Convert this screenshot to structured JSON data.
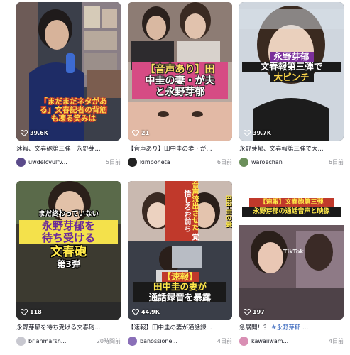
{
  "cards": [
    {
      "likes": "39.6K",
      "overlay": [
        "「まだまだネタがあ",
        "る」文春記者の背筋",
        "も凍る笑みは"
      ],
      "description": "速報、文春砲第三弾　永野芽...",
      "author": "uwdelcvulfv...",
      "date": "5日前",
      "avatar_color": "#5a4a8a"
    },
    {
      "likes": "21",
      "overlay": [
        "【音声あり】田",
        "中圭の妻・が夫",
        "と永野芽郁"
      ],
      "description": "【音声あり】田中圭の妻・が...",
      "author": "kimboheta",
      "date": "6日前",
      "avatar_color": "#222222"
    },
    {
      "likes": "39.7K",
      "overlay": [
        "永野芽郁",
        "文春報第三弾で",
        "大ピンチ"
      ],
      "description": "永野芽郁、文春報第三弾で大...",
      "author": "waroechan",
      "date": "6日前",
      "avatar_color": "#6b8f5a"
    },
    {
      "likes": "118",
      "overlay": [
        "まだ終わっていない",
        "永野芽郁を",
        "待ち受ける",
        "文春砲",
        "第3弾"
      ],
      "description": "永野芽郁を待ち受ける文春砲...",
      "author": "brianmarsh...",
      "date": "20時間前",
      "avatar_color": "#c8c8d0"
    },
    {
      "likes": "44.9K",
      "overlay": [
        "【速報】",
        "田中圭の妻が",
        "通話録音を暴露"
      ],
      "side_text": [
        "音声流出させた",
        "覚悟しろお前ら",
        "田中圭の妻"
      ],
      "description": "【速報】田中圭の妻が通話録...",
      "author": "banossione...",
      "date": "4日前",
      "avatar_color": "#8a6fb8"
    },
    {
      "likes": "197",
      "overlay": [
        "【速報】文春砲第三弾",
        "永野芽郁の通話音声と映像"
      ],
      "watermark": "TikTok",
      "description_plain": "急展開！？",
      "description_tag": "#永野芽郁",
      "description_tail": "...",
      "author": "kawaiiwam...",
      "date": "4日前",
      "avatar_color": "#d98fb4"
    }
  ]
}
